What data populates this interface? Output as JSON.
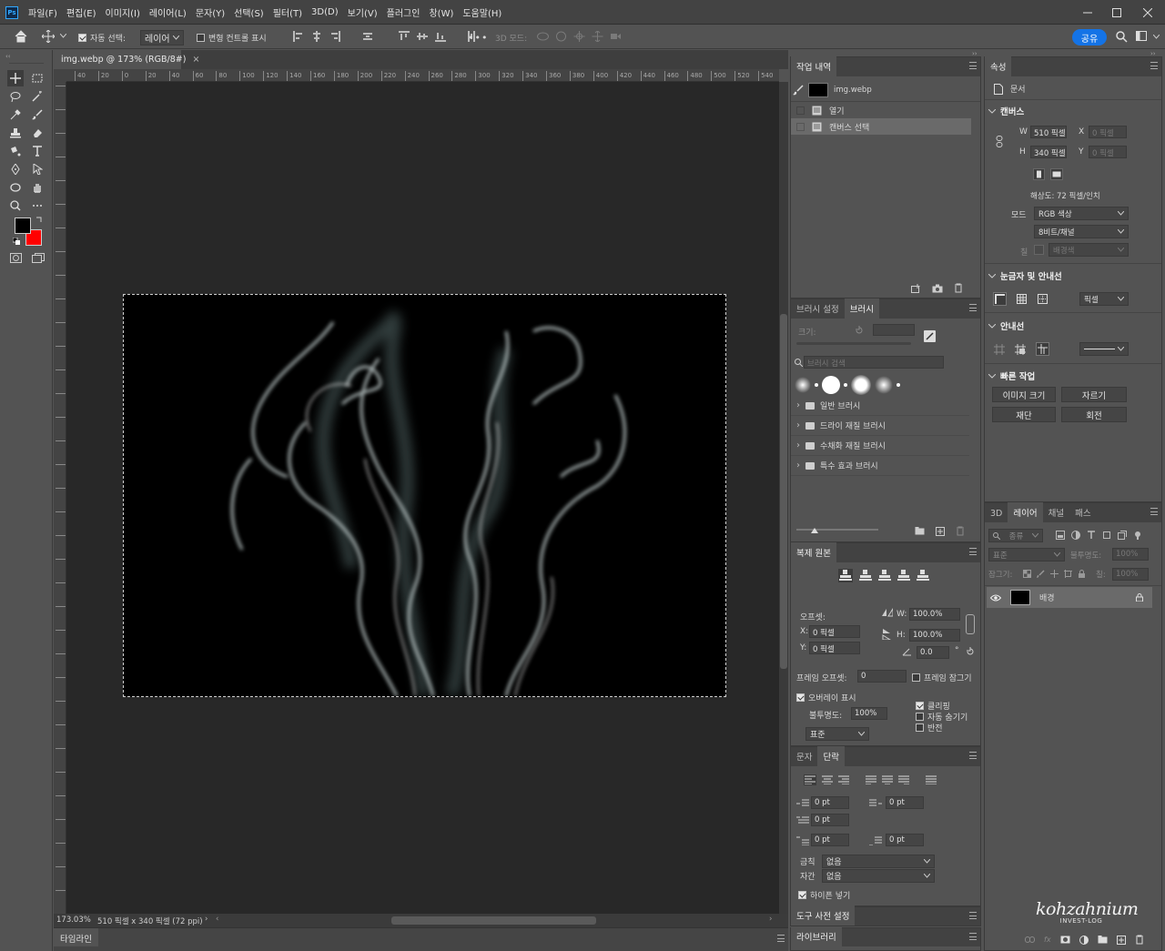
{
  "app": {
    "logo": "Ps",
    "menu": [
      "파일(F)",
      "편집(E)",
      "이미지(I)",
      "레이어(L)",
      "문자(Y)",
      "선택(S)",
      "필터(T)",
      "3D(D)",
      "보기(V)",
      "플러그인",
      "창(W)",
      "도움말(H)"
    ],
    "window_controls": [
      "minimize-icon",
      "maximize-icon",
      "close-icon"
    ]
  },
  "options_bar": {
    "auto_select_label": "자동 선택:",
    "auto_select_checked": true,
    "auto_select_target": "레이어",
    "transform_controls_label": "변형 컨트롤 표시",
    "transform_controls_checked": false,
    "more": "•••",
    "mode_3d_label": "3D 모드:",
    "share_label": "공유"
  },
  "document": {
    "tab_title": "img.webp @ 173% (RGB/8#)",
    "close_glyph": "×",
    "ruler_top_labels": [
      "40",
      "20",
      "0",
      "20",
      "40",
      "60",
      "80",
      "100",
      "120",
      "140",
      "160",
      "180",
      "200",
      "220",
      "240",
      "260",
      "280",
      "300",
      "320",
      "340",
      "360",
      "380",
      "400",
      "420",
      "440",
      "460",
      "480",
      "500",
      "520",
      "540"
    ],
    "zoom": "173.03%",
    "size_info": "510 픽셀 x 340 픽셀 (72 ppi)",
    "timeline_label": "타임라인"
  },
  "history_panel": {
    "tab": "작업 내역",
    "snapshot_name": "img.webp",
    "items": [
      "열기",
      "캔버스 선택"
    ]
  },
  "brush_panel": {
    "tabs": [
      "브러시 설정",
      "브러시"
    ],
    "size_label": "크기:",
    "search_placeholder": "브러시 검색",
    "groups": [
      "일반 브러시",
      "드라이 재질 브러시",
      "수채화 재질 브러시",
      "특수 효과 브러시"
    ]
  },
  "clone_panel": {
    "tab": "복제 원본",
    "offset_label": "오프셋:",
    "x_label": "X:",
    "x_value": "0 픽셀",
    "y_label": "Y:",
    "y_value": "0 픽셀",
    "w_label": "W:",
    "w_value": "100.0%",
    "h_label": "H:",
    "h_value": "100.0%",
    "angle_value": "0.0",
    "angle_unit": "°",
    "frame_offset_label": "프레임 오프셋:",
    "frame_offset_value": "0",
    "frame_lock_label": "프레임 잠그기",
    "show_overlay_label": "오버레이 표시",
    "opacity_label": "불투명도:",
    "opacity_value": "100%",
    "blend_value": "표준",
    "clipped_label": "클리핑",
    "auto_hide_label": "자동 숨기기",
    "invert_label": "반전"
  },
  "paragraph_panel": {
    "tabs": [
      "문자",
      "단락"
    ],
    "indent_left": "0 pt",
    "indent_right": "0 pt",
    "indent_first": "0 pt",
    "space_before": "0 pt",
    "space_after": "0 pt",
    "kinsoku_label": "금칙",
    "kinsoku_value": "없음",
    "mojikumi_label": "자간",
    "mojikumi_value": "없음",
    "hyphenate_label": "하이픈 넣기"
  },
  "tool_presets": {
    "tab": "도구 사전 설정"
  },
  "libraries": {
    "tab": "라이브러리"
  },
  "properties_panel": {
    "tab": "속성",
    "doc_label": "문서",
    "canvas_title": "캔버스",
    "w_label": "W",
    "w_value": "510 픽셀",
    "h_label": "H",
    "h_value": "340 픽셀",
    "x_label": "X",
    "x_value": "0 픽셀",
    "y_label": "Y",
    "y_value": "0 픽셀",
    "resolution": "해상도: 72 픽셀/인치",
    "mode_label": "모드",
    "mode_value": "RGB 색상",
    "depth_value": "8비트/채널",
    "fill_label": "칠",
    "fill_value": "배경색",
    "rulers_title": "눈금자 및 안내선",
    "ruler_unit": "픽셀",
    "guides_title": "안내선",
    "quick_title": "빠른 작업",
    "quick_buttons": [
      "이미지 크기",
      "자르기",
      "재단",
      "회전"
    ]
  },
  "layers_panel": {
    "tabs": [
      "3D",
      "레이어",
      "채널",
      "패스"
    ],
    "kind_placeholder": "종류",
    "blend_mode": "표준",
    "opacity_label": "불투명도:",
    "opacity_value": "100%",
    "lock_label": "잠그기:",
    "fill_label": "칠:",
    "fill_value": "100%",
    "layer_name": "배경"
  },
  "watermark": {
    "main": "kohzahnium",
    "sub": "INVEST-LOG"
  },
  "colors": {
    "accent": "#1473e6",
    "background_swatch": "#ff0000",
    "foreground_swatch": "#000000"
  }
}
